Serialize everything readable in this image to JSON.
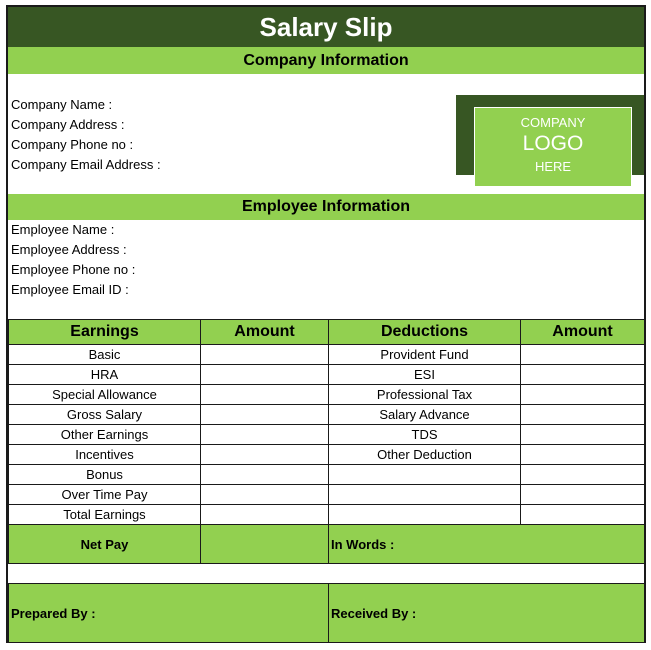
{
  "title": "Salary Slip",
  "company": {
    "heading": "Company Information",
    "fields": [
      "Company Name :",
      "Company Address :",
      "Company Phone no :",
      "Company Email Address :"
    ],
    "logo": [
      "COMPANY",
      "LOGO",
      "HERE"
    ]
  },
  "employee": {
    "heading": "Employee Information",
    "fields": [
      "Employee Name :",
      "Employee Address :",
      "Employee Phone no :",
      "Employee Email ID :"
    ]
  },
  "table": {
    "headers": [
      "Earnings",
      "Amount",
      "Deductions",
      "Amount"
    ],
    "earnings": [
      "Basic",
      "HRA",
      "Special Allowance",
      "Gross Salary",
      "Other Earnings",
      "Incentives",
      "Bonus",
      "Over Time Pay",
      "Total Earnings"
    ],
    "deductions": [
      "Provident Fund",
      "ESI",
      "Professional Tax",
      "Salary Advance",
      "TDS",
      "Other Deduction",
      "",
      "",
      ""
    ],
    "net_pay": "Net Pay",
    "in_words": "In Words :",
    "prepared_by": "Prepared By :",
    "received_by": "Received By :"
  },
  "colors": {
    "dark_green": "#375623",
    "light_green": "#92d050"
  }
}
